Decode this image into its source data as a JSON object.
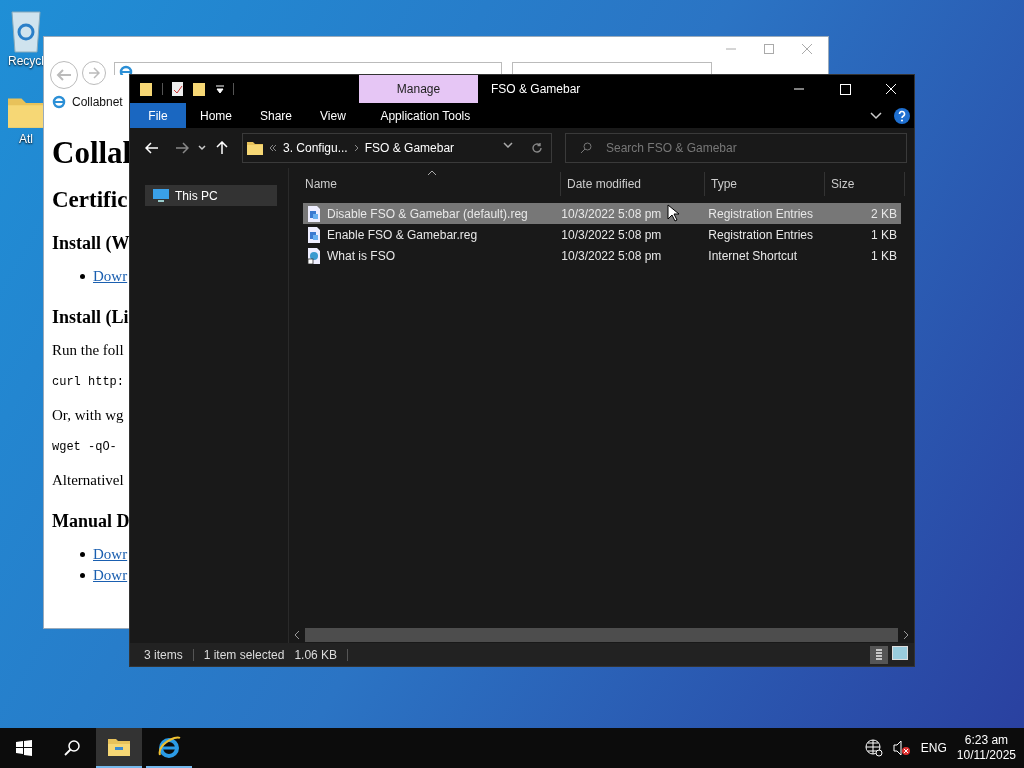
{
  "desktop_icons": [
    {
      "label": "Recycl",
      "kind": "bin"
    },
    {
      "label": "Atl",
      "kind": "folder"
    }
  ],
  "browser": {
    "tab_title": "Collabnet",
    "content": [
      {
        "kind": "h1",
        "text": "Collal"
      },
      {
        "kind": "h2",
        "text": "Certific"
      },
      {
        "kind": "h3",
        "text": "Install (W"
      },
      {
        "kind": "link",
        "text": "Dowr"
      },
      {
        "kind": "h3",
        "text": "Install (Li"
      },
      {
        "kind": "p",
        "text": "Run the foll"
      },
      {
        "kind": "code",
        "text": "curl http:"
      },
      {
        "kind": "p",
        "text": "Or, with wg"
      },
      {
        "kind": "code",
        "text": "wget -qO-"
      },
      {
        "kind": "p",
        "text": "Alternativel"
      },
      {
        "kind": "h3",
        "text": "Manual D"
      },
      {
        "kind": "link",
        "text": "Dowr"
      },
      {
        "kind": "link",
        "text": "Dowr"
      }
    ]
  },
  "explorer": {
    "title": "FSO & Gamebar",
    "contextual_tab": "Manage",
    "ribbon_tabs": [
      {
        "label": "File",
        "kind": "file"
      },
      {
        "label": "Home",
        "kind": "tab"
      },
      {
        "label": "Share",
        "kind": "tab"
      },
      {
        "label": "View",
        "kind": "tab"
      },
      {
        "label": "Application Tools",
        "kind": "context"
      }
    ],
    "breadcrumb": [
      {
        "label": "3. Configu..."
      },
      {
        "label": "FSO & Gamebar"
      }
    ],
    "search_placeholder": "Search FSO & Gamebar",
    "nav_items": [
      {
        "label": "This PC",
        "selected": true
      }
    ],
    "columns": [
      "Name",
      "Date modified",
      "Type",
      "Size"
    ],
    "rows": [
      {
        "name": "Disable FSO & Gamebar (default).reg",
        "date": "10/3/2022 5:08 pm",
        "type": "Registration Entries",
        "size": "2 KB",
        "kind": "reg",
        "selected": true
      },
      {
        "name": "Enable FSO & Gamebar.reg",
        "date": "10/3/2022 5:08 pm",
        "type": "Registration Entries",
        "size": "1 KB",
        "kind": "reg",
        "selected": false
      },
      {
        "name": "What is FSO",
        "date": "10/3/2022 5:08 pm",
        "type": "Internet Shortcut",
        "size": "1 KB",
        "kind": "url",
        "selected": false
      }
    ],
    "status": {
      "count": "3 items",
      "selection": "1 item selected",
      "size": "1.06 KB"
    }
  },
  "taskbar": {
    "apps": [
      {
        "kind": "explorer",
        "selected": true
      },
      {
        "kind": "ie",
        "selected": false
      }
    ],
    "language": "ENG",
    "time": "6:23 am",
    "date": "10/11/2025"
  }
}
